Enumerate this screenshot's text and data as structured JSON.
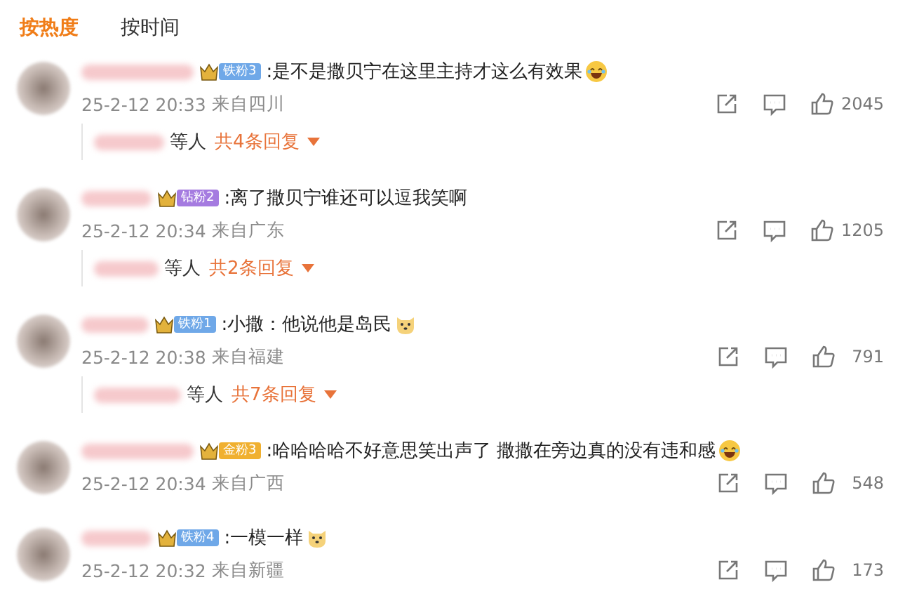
{
  "sort_tabs": [
    {
      "label": "按热度",
      "selected": true
    },
    {
      "label": "按时间",
      "selected": false
    }
  ],
  "comments": [
    {
      "badge": {
        "label": "铁粉3",
        "color": "#6fa8e8"
      },
      "text": ":是不是撒贝宁在这里主持才这么有效果",
      "emoji": {
        "kind": "laugh"
      },
      "time": "25-2-12 20:33",
      "location": "来自四川",
      "likes": "2045",
      "replies": {
        "suffix": "等人",
        "count": "共4条回复"
      }
    },
    {
      "badge": {
        "label": "钻粉2",
        "color": "#a57be0"
      },
      "text": ":离了撒贝宁谁还可以逗我笑啊",
      "time": "25-2-12 20:34",
      "location": "来自广东",
      "likes": "1205",
      "replies": {
        "suffix": "等人",
        "count": "共2条回复"
      }
    },
    {
      "badge": {
        "label": "铁粉1",
        "color": "#6fa8e8"
      },
      "text": ":小撒：他说他是岛民",
      "emoji": {
        "kind": "dog"
      },
      "time": "25-2-12 20:38",
      "location": "来自福建",
      "likes": "791",
      "replies": {
        "suffix": "等人",
        "count": "共7条回复"
      }
    },
    {
      "badge": {
        "label": "金粉3",
        "color": "#f0b030"
      },
      "text": ":哈哈哈哈不好意思笑出声了 撒撒在旁边真的没有违和感",
      "emoji": {
        "kind": "laugh"
      },
      "time": "25-2-12 20:34",
      "location": "来自广西",
      "likes": "548"
    },
    {
      "badge": {
        "label": "铁粉4",
        "color": "#6fa8e8"
      },
      "text": ":一模一样",
      "emoji": {
        "kind": "dog"
      },
      "time": "25-2-12 20:32",
      "location": "来自新疆",
      "likes": "173"
    }
  ]
}
